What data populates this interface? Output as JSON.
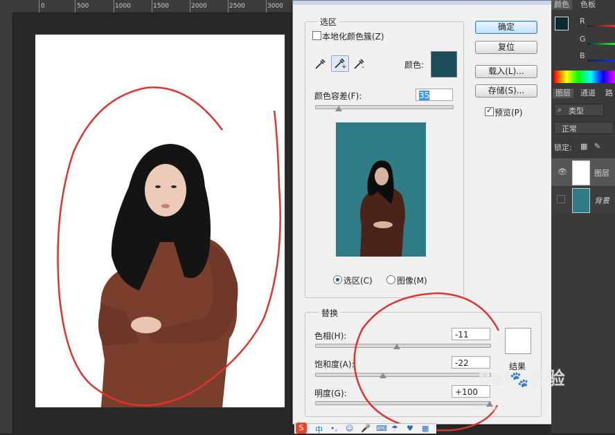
{
  "ruler": {
    "labels": [
      "0",
      "500",
      "1000",
      "1500",
      "2000",
      "2500",
      "3000"
    ]
  },
  "dialog": {
    "selection_legend": "选区",
    "localized_clusters": "本地化颜色簇(Z)",
    "color_label": "颜色:",
    "sample_color": "#1c4e5c",
    "fuzziness_label": "颜色容差(F):",
    "fuzziness_value": "35",
    "fuzziness_level": 0.17,
    "radio_selection": "选区(C)",
    "radio_image": "图像(M)",
    "replace_legend": "替换",
    "hue_label": "色相(H):",
    "hue_value": "-11",
    "hue_level": 0.47,
    "sat_label": "饱和度(A):",
    "sat_value": "-22",
    "sat_level": 0.39,
    "light_label": "明度(G):",
    "light_value": "+100",
    "light_level": 1.0,
    "result_label": "结果",
    "result_color": "#ffffff",
    "ok_label": "确定",
    "reset_label": "复位",
    "load_label": "载入(L)...",
    "save_label": "存储(S)...",
    "preview_label": "预览(P)"
  },
  "panel": {
    "tab_color": "颜色",
    "tab_swatches": "色板",
    "ch_r": "R",
    "ch_g": "G",
    "ch_b": "B",
    "fg_color": "#0d2a2e",
    "tab_layers": "图层",
    "tab_channels": "通道",
    "tab_paths": "路",
    "filter_label": "类型",
    "blend_mode": "正常",
    "lock_label": "锁定:",
    "layer1": "图层",
    "layer2": "背景"
  },
  "watermark": {
    "brand": "Bai",
    "brand2": "经验",
    "url": "jingyan.baidu.com"
  }
}
